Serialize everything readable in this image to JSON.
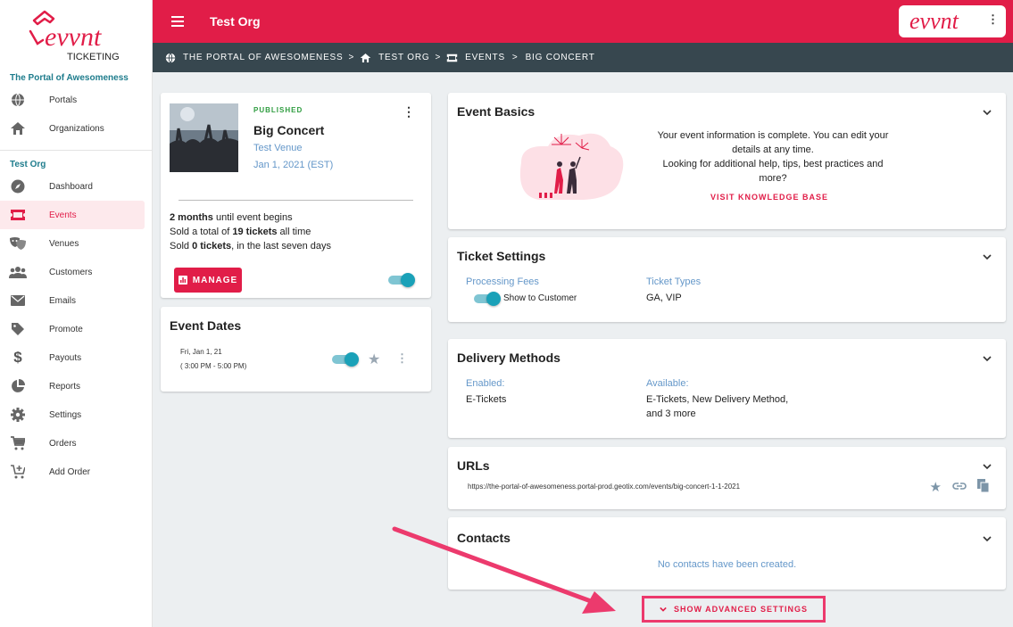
{
  "brand": {
    "logo_text": "evvnt",
    "logo_sub": "TICKETING",
    "topbar_logo": "evvnt"
  },
  "sidebar": {
    "portal_title": "The Portal of Awesomeness",
    "portal_items": [
      {
        "label": "Portals",
        "icon": "globe-icon"
      },
      {
        "label": "Organizations",
        "icon": "home-icon"
      }
    ],
    "org_title": "Test Org",
    "org_items": [
      {
        "label": "Dashboard",
        "icon": "compass-icon"
      },
      {
        "label": "Events",
        "icon": "ticket-icon",
        "active": true
      },
      {
        "label": "Venues",
        "icon": "masks-icon"
      },
      {
        "label": "Customers",
        "icon": "people-icon"
      },
      {
        "label": "Emails",
        "icon": "mail-icon"
      },
      {
        "label": "Promote",
        "icon": "tag-icon"
      },
      {
        "label": "Payouts",
        "icon": "dollar-icon"
      },
      {
        "label": "Reports",
        "icon": "pie-icon"
      },
      {
        "label": "Settings",
        "icon": "gear-icon"
      },
      {
        "label": "Orders",
        "icon": "cart-icon"
      },
      {
        "label": "Add Order",
        "icon": "cart-add-icon"
      }
    ]
  },
  "topbar": {
    "title": "Test Org",
    "menu_icon": "more-vert-icon"
  },
  "breadcrumb": {
    "items": [
      "THE PORTAL OF AWESOMENESS",
      "TEST ORG",
      "EVENTS",
      "BIG CONCERT"
    ],
    "sep": ">"
  },
  "event": {
    "status": "PUBLISHED",
    "name": "Big Concert",
    "venue": "Test Venue",
    "date": "Jan 1, 2021 (EST)",
    "stat1_bold": "2 months",
    "stat1_rest": " until event begins",
    "stat2_pre": "Sold a total of ",
    "stat2_bold": "19 tickets",
    "stat2_rest": " all time",
    "stat3_pre": "Sold ",
    "stat3_bold": "0 tickets",
    "stat3_rest": ", in the last seven days",
    "manage_label": "MANAGE",
    "published_toggle": true
  },
  "event_dates": {
    "title": "Event Dates",
    "date": "Fri, Jan 1, 21",
    "time": "( 3:00 PM - 5:00 PM)"
  },
  "basics": {
    "title": "Event Basics",
    "line1": "Your event information is complete. You can edit your",
    "line2": "details at any time.",
    "line3": "Looking for additional help, tips, best practices and",
    "line4": "more?",
    "link": "VISIT KNOWLEDGE BASE"
  },
  "ticket_settings": {
    "title": "Ticket Settings",
    "fees_label": "Processing Fees",
    "fees_toggle_label": "Show to Customer",
    "types_label": "Ticket Types",
    "types_value": "GA, VIP"
  },
  "delivery": {
    "title": "Delivery Methods",
    "enabled_label": "Enabled:",
    "enabled_value": "E-Tickets",
    "available_label": "Available:",
    "available_line1": "E-Tickets, New Delivery Method,",
    "available_line2": "and 3 more"
  },
  "urls": {
    "title": "URLs",
    "url": "https://the-portal-of-awesomeness.portal-prod.geotix.com/events/big-concert-1-1-2021"
  },
  "contacts": {
    "title": "Contacts",
    "empty": "No contacts have been created."
  },
  "advanced": {
    "label": "SHOW ADVANCED SETTINGS"
  },
  "colors": {
    "accent": "#e11d48",
    "teal": "#1aa1b8",
    "crumb_bg": "#37474f",
    "annotation": "#ec3a6d"
  }
}
